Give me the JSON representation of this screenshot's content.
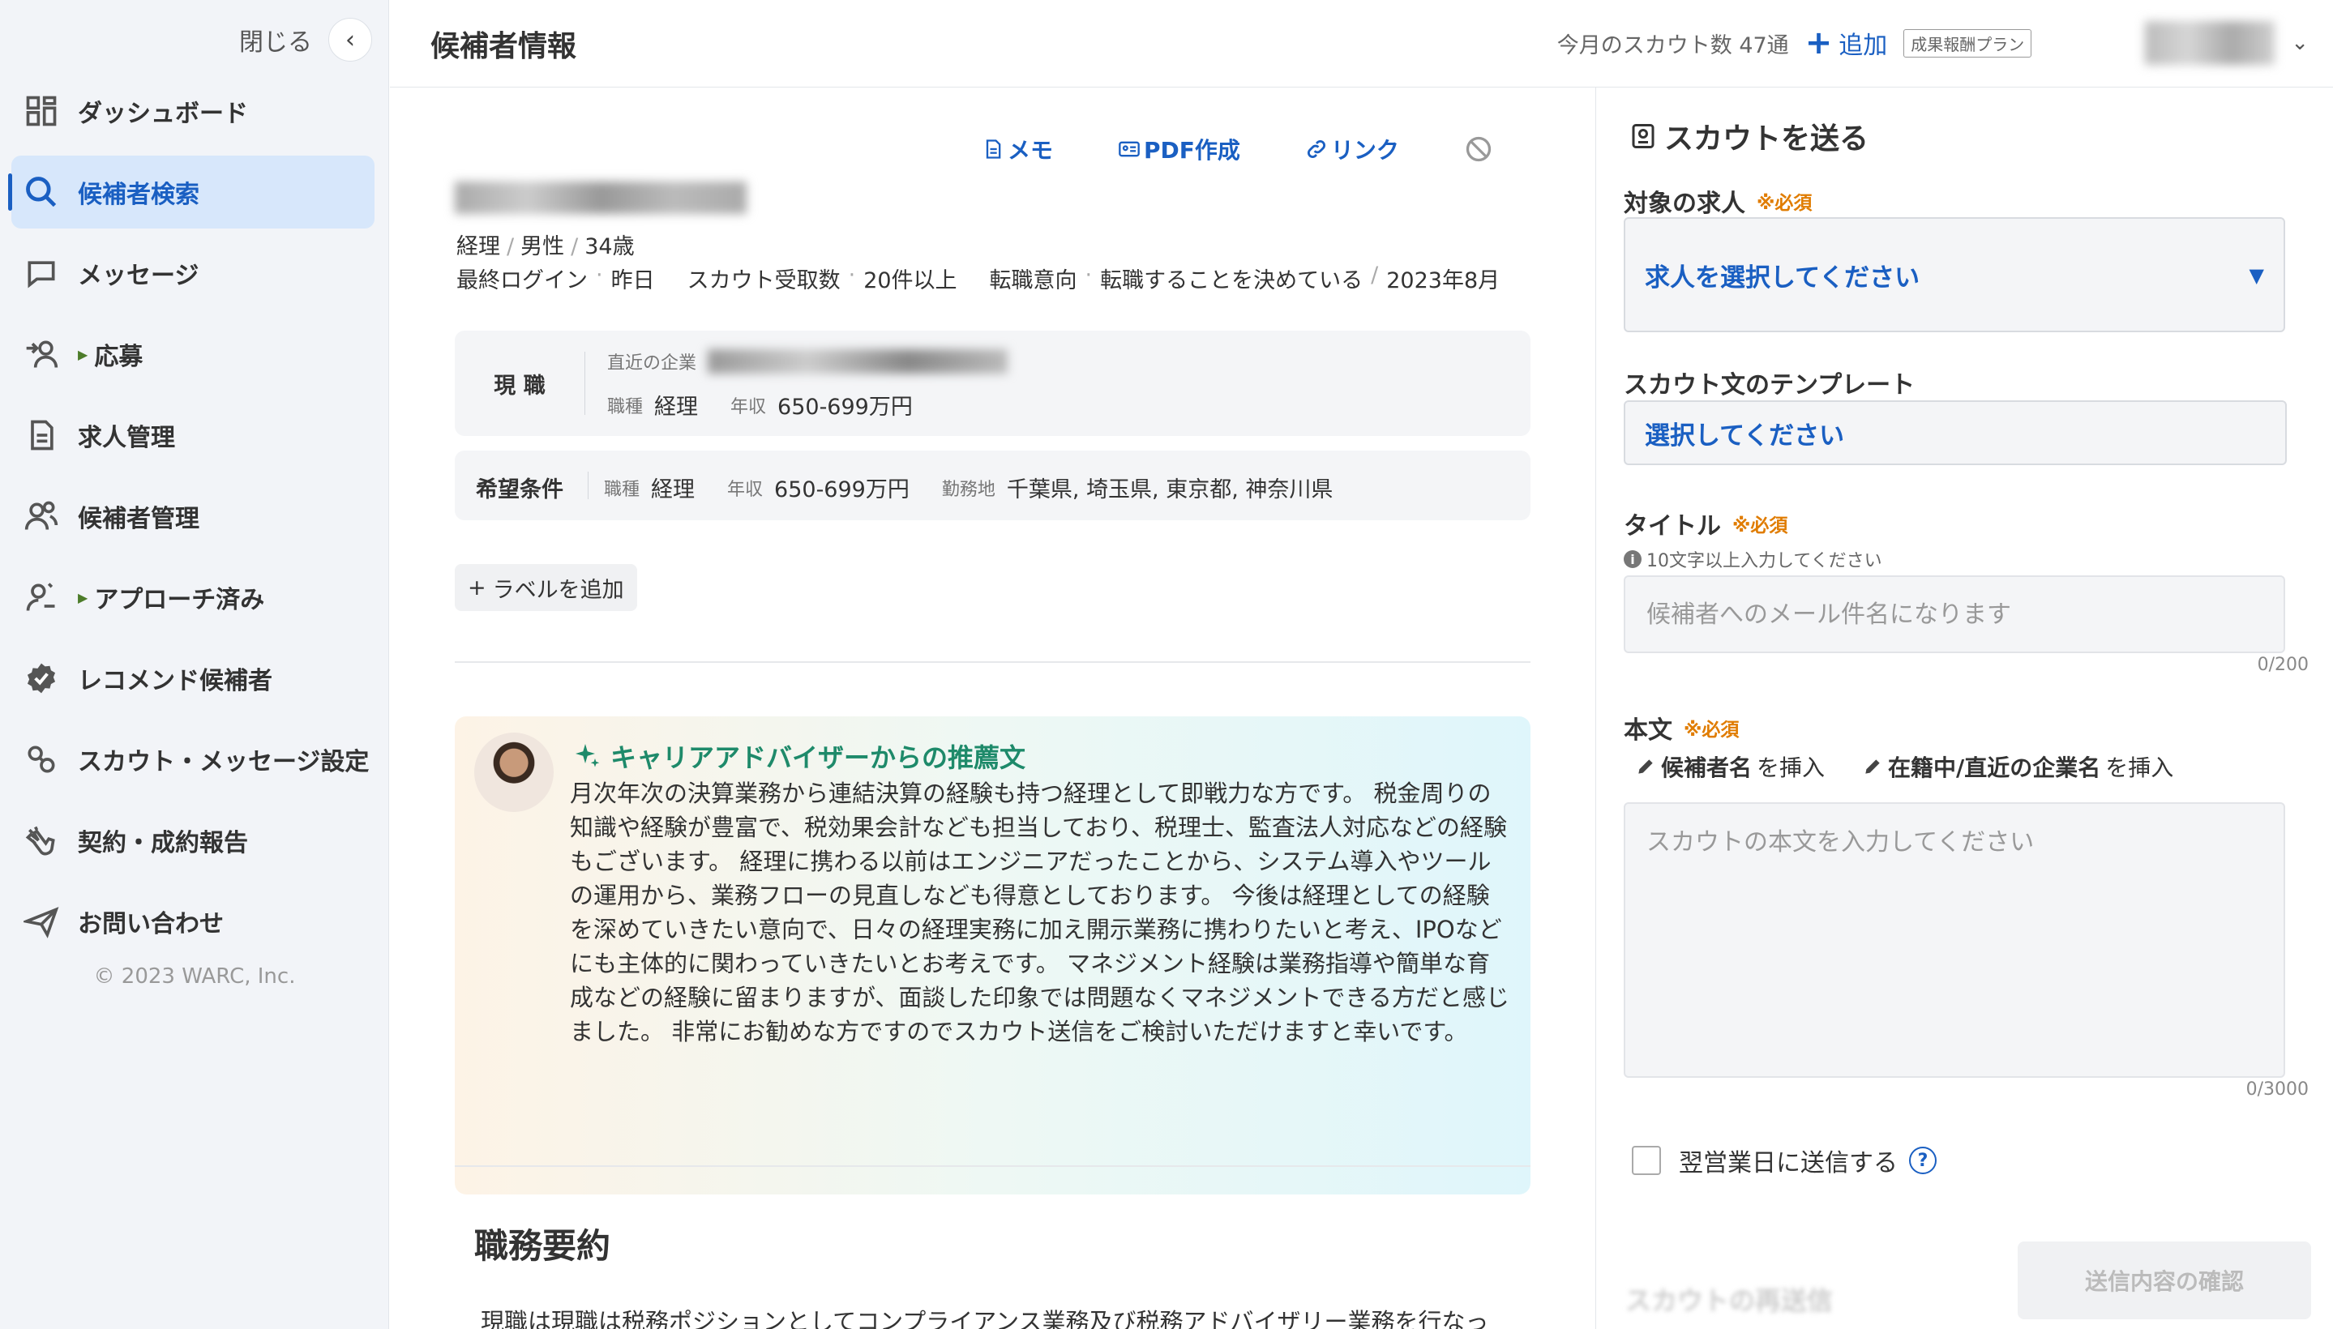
{
  "sidebar": {
    "close_label": "閉じる",
    "close_icon": "‹",
    "items": [
      {
        "label": "ダッシュボード",
        "icon": "grid-icon"
      },
      {
        "label": "候補者検索",
        "icon": "search-icon",
        "active": true
      },
      {
        "label": "メッセージ",
        "icon": "chat-icon"
      },
      {
        "label": "応募",
        "icon": "user-arrow-icon"
      },
      {
        "label": "求人管理",
        "icon": "document-icon"
      },
      {
        "label": "候補者管理",
        "icon": "users-icon"
      },
      {
        "label": "アプローチ済み",
        "icon": "user-approach-icon"
      },
      {
        "label": "レコメンド候補者",
        "icon": "badge-check-icon"
      },
      {
        "label": "スカウト・メッセージ設定",
        "icon": "settings-link-icon"
      },
      {
        "label": "契約・成約報告",
        "icon": "clap-icon"
      },
      {
        "label": "お問い合わせ",
        "icon": "paper-plane-icon"
      }
    ],
    "copyright": "© 2023 WARC, Inc."
  },
  "header": {
    "title": "候補者情報",
    "scout_count": "今月のスカウト数 47通",
    "add_label": "追加",
    "plan_badge": "成果報酬プラン",
    "user_caret": "⌄"
  },
  "candidate": {
    "actions": {
      "memo": "メモ",
      "pdf": "PDF作成",
      "link": "リンク"
    },
    "meta": {
      "job": "経理",
      "gender": "男性",
      "age": "34歳"
    },
    "stats": {
      "login_label": "最終ログイン",
      "login_value": "昨日",
      "scout_label": "スカウト受取数",
      "scout_value": "20件以上",
      "intent_label": "転職意向",
      "intent_value": "転職することを決めている",
      "date": "2023年8月"
    },
    "current": {
      "label": "現 職",
      "company_label": "直近の企業",
      "job_label": "職種",
      "job_value": "経理",
      "salary_label": "年収",
      "salary_value": "650-699万円"
    },
    "desired": {
      "label": "希望条件",
      "job_label": "職種",
      "job_value": "経理",
      "salary_label": "年収",
      "salary_value": "650-699万円",
      "location_label": "勤務地",
      "location_value": "千葉県, 埼玉県, 東京都, 神奈川県"
    },
    "add_label": "ラベルを追加",
    "recommendation": {
      "title": "キャリアアドバイザーからの推薦文",
      "body": "月次年次の決算業務から連結決算の経験も持つ経理として即戦力な方です。 税金周りの知識や経験が豊富で、税効果会計なども担当しており、税理士、監査法人対応などの経験もございます。 経理に携わる以前はエンジニアだったことから、システム導入やツールの運用から、業務フローの見直しなども得意としております。 今後は経理としての経験を深めていきたい意向で、日々の経理実務に加え開示業務に携わりたいと考え、IPOなどにも主体的に関わっていきたいとお考えです。 マネジメント経験は業務指導や簡単な育成などの経験に留まりますが、面談した印象では問題なくマネジメントできる方だと感じました。 非常にお勧めな方ですのでスカウト送信をご検討いただけますと幸いです。"
    },
    "summary_title": "職務要約",
    "summary_body": "現職は現職は税務ポジションとしてコンプライアンス業務及び税務アドバイザリー業務を行なっ"
  },
  "scout": {
    "title": "スカウトを送る",
    "required": "※必須",
    "job_label": "対象の求人",
    "job_placeholder": "求人を選択してください",
    "template_label": "スカウト文のテンプレート",
    "template_placeholder": "選択してください",
    "title_label": "タイトル",
    "title_hint": "10文字以上入力してください",
    "title_placeholder": "候補者へのメール件名になります",
    "title_counter": "0/200",
    "body_label": "本文",
    "insert_name_bold": "候補者名",
    "insert_company_bold": "在籍中/直近の企業名",
    "insert_suffix": "を挿入",
    "body_placeholder": "スカウトの本文を入力してください",
    "body_counter": "0/3000",
    "next_day_label": "翌営業日に送信する",
    "confirm_label": "送信内容の確認",
    "resend_label": "スカウトの再送信"
  }
}
